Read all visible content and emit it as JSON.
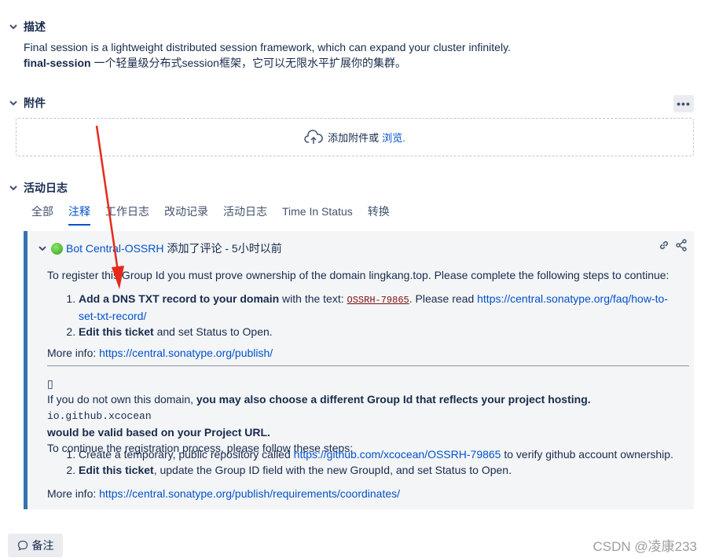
{
  "description": {
    "title": "描述",
    "line1": "Final session is a lightweight distributed session framework, which can expand your cluster infinitely.",
    "line2_bold": "final-session",
    "line2_rest": " 一个轻量级分布式session框架，它可以无限水平扩展你的集群。"
  },
  "attachments": {
    "title": "附件",
    "more_label": "•••",
    "drop_text": "添加附件或",
    "browse_label": "浏览."
  },
  "activity": {
    "title": "活动日志",
    "tabs": [
      "全部",
      "注释",
      "工作日志",
      "改动记录",
      "活动日志",
      "Time In Status",
      "转换"
    ],
    "active_tab": "注释"
  },
  "comment": {
    "author": "Bot Central-OSSRH",
    "meta": "添加了评论 - 5小时以前",
    "intro": "To register this Group Id you must prove ownership of the domain lingkang.top. Please complete the following steps to continue:",
    "step1_bold": "Add a DNS TXT record to your domain",
    "step1_mid": " with the text: ",
    "step1_code": "OSSRH-79865",
    "step1_after": ". Please read ",
    "step1_link": "https://central.sonatype.org/faq/how-to-set-txt-record/",
    "step2_bold": "Edit this ticket",
    "step2_rest": " and set Status to Open.",
    "more_info_label": "More info: ",
    "more_info_link": "https://central.sonatype.org/publish/",
    "glyph": "▯",
    "alt_pre": "If you do not own this domain, ",
    "alt_bold": "you may also choose a different Group Id that reflects your project hosting. ",
    "alt_mono": "io.github.xcocean",
    "alt_bold2": "would be valid based on your Project URL.",
    "continue_text": "To continue the registration process, please follow these steps:",
    "alt_step1_pre": "Create a temporary, public repository called ",
    "alt_step1_link": "https://github.com/xcocean/OSSRH-79865",
    "alt_step1_post": " to verify github account ownership.",
    "alt_step2_bold": "Edit this ticket",
    "alt_step2_rest": ", update the Group ID field with the new GroupId, and set Status to Open.",
    "more_info2_link": "https://central.sonatype.org/publish/requirements/coordinates/"
  },
  "note_button": "备注",
  "watermark": "CSDN @凌康233",
  "colors": {
    "link": "#0052cc",
    "accent_bar": "#3572b0",
    "annotation_arrow": "#e8291c"
  }
}
